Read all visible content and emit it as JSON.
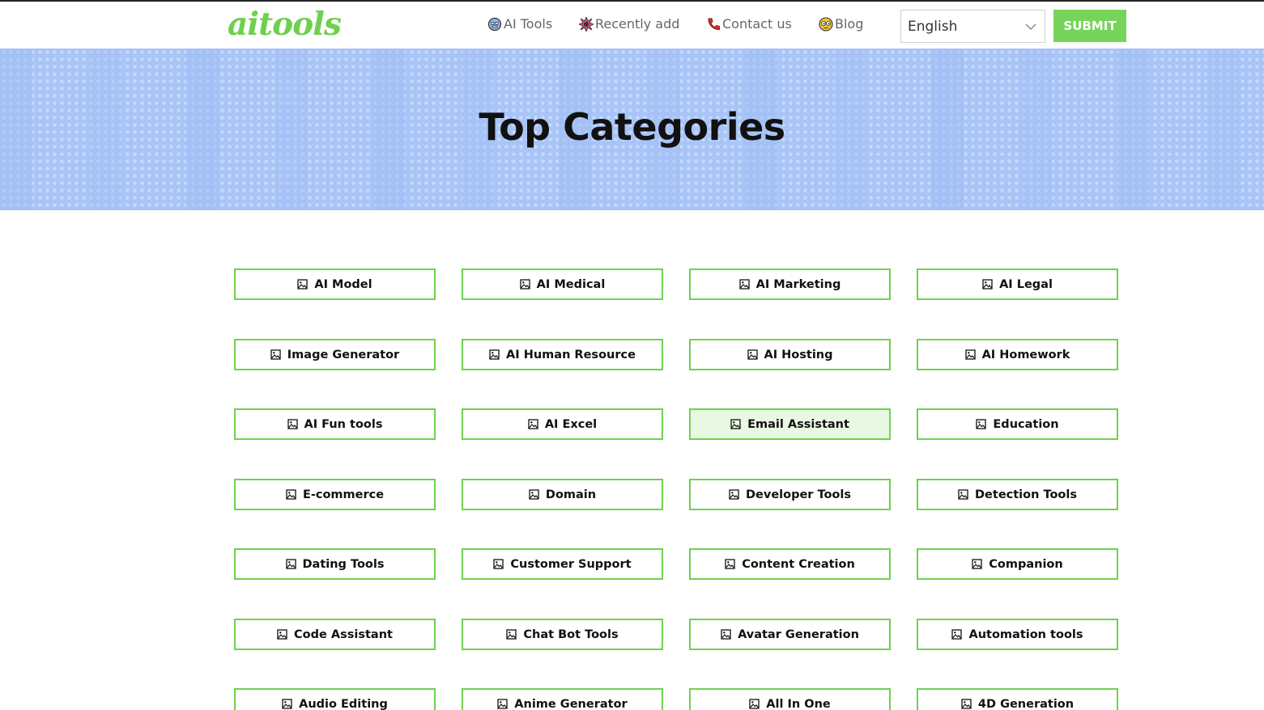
{
  "header": {
    "logo": "aitools",
    "nav": [
      {
        "label": "AI Tools",
        "icon": "robot-face-icon"
      },
      {
        "label": "Recently add",
        "icon": "spark-burst-icon"
      },
      {
        "label": "Contact us",
        "icon": "telephone-icon"
      },
      {
        "label": "Blog",
        "icon": "eyes-face-icon"
      }
    ],
    "language": {
      "selected": "English"
    },
    "submit_label": "SUBMIT"
  },
  "hero": {
    "title": "Top Categories"
  },
  "categories": [
    "AI Model",
    "AI Medical",
    "AI Marketing",
    "AI Legal",
    "Image Generator",
    "AI Human Resource",
    "AI Hosting",
    "AI Homework",
    "AI Fun tools",
    "AI Excel",
    "Email Assistant",
    "Education",
    "E-commerce",
    "Domain",
    "Developer Tools",
    "Detection Tools",
    "Dating Tools",
    "Customer Support",
    "Content Creation",
    "Companion",
    "Code Assistant",
    "Chat Bot Tools",
    "Avatar Generation",
    "Automation tools",
    "Audio Editing",
    "Anime Generator",
    "All In One",
    "4D Generation"
  ],
  "category_icon": "image-icon",
  "active_category": "Email Assistant",
  "colors": {
    "accent": "#6fd14f",
    "hero_bg": "#a9c4f7",
    "logo": "#6fcf4e"
  }
}
